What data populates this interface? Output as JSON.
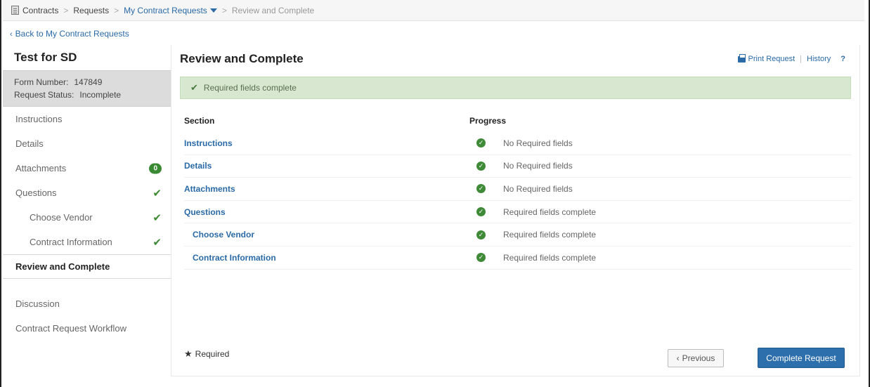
{
  "breadcrumb": {
    "items": [
      "Contracts",
      "Requests",
      "My Contract Requests",
      "Review and Complete"
    ]
  },
  "back_link": "Back to My Contract Requests",
  "sidebar": {
    "title": "Test for SD",
    "form_number_label": "Form Number:",
    "form_number": "147849",
    "status_label": "Request Status:",
    "status": "Incomplete",
    "items": [
      {
        "label": "Instructions"
      },
      {
        "label": "Details"
      },
      {
        "label": "Attachments",
        "badge": "0"
      },
      {
        "label": "Questions"
      },
      {
        "label": "Choose Vendor"
      },
      {
        "label": "Contract Information"
      },
      {
        "label": "Review and Complete"
      },
      {
        "label": "Discussion"
      },
      {
        "label": "Contract Request Workflow"
      }
    ]
  },
  "main": {
    "title": "Review and Complete",
    "toolbar": {
      "print": "Print Request",
      "history": "History",
      "help": "?"
    },
    "alert": "Required fields complete",
    "columns": {
      "section": "Section",
      "progress": "Progress"
    },
    "rows": [
      {
        "section": "Instructions",
        "status": "No Required fields"
      },
      {
        "section": "Details",
        "status": "No Required fields"
      },
      {
        "section": "Attachments",
        "status": "No Required fields"
      },
      {
        "section": "Questions",
        "status": "Required fields complete"
      },
      {
        "section": "Choose Vendor",
        "status": "Required fields complete"
      },
      {
        "section": "Contract Information",
        "status": "Required fields complete"
      }
    ],
    "required_legend": "Required",
    "buttons": {
      "previous": "Previous",
      "complete": "Complete Request"
    }
  },
  "colors": {
    "link": "#2a6aa6",
    "success": "#3e8a37",
    "primary_button": "#2d6fac",
    "alert_bg": "#d8e8d0"
  }
}
